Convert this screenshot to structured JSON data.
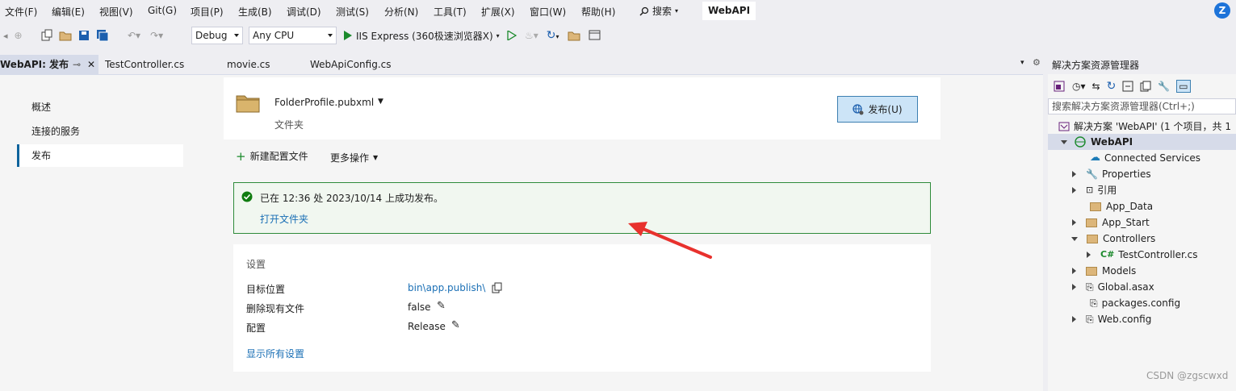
{
  "menu": {
    "items": [
      "文件(F)",
      "编辑(E)",
      "视图(V)",
      "Git(G)",
      "项目(P)",
      "生成(B)",
      "调试(D)",
      "测试(S)",
      "分析(N)",
      "工具(T)",
      "扩展(X)",
      "窗口(W)",
      "帮助(H)"
    ],
    "search_label": "搜索",
    "solution_name": "WebAPI",
    "avatar_letter": "Z"
  },
  "toolbar": {
    "config": "Debug",
    "platform": "Any CPU",
    "run_target": "IIS Express (360极速浏览器X)"
  },
  "tabs": {
    "active": "WebAPI: 发布",
    "files": [
      "TestController.cs",
      "movie.cs",
      "WebApiConfig.cs"
    ]
  },
  "left_nav": {
    "items": [
      "概述",
      "连接的服务",
      "发布"
    ],
    "selected": "发布"
  },
  "profile": {
    "name": "FolderProfile.pubxml",
    "type": "文件夹",
    "publish_button": "发布(U)"
  },
  "actions": {
    "new_profile": "新建配置文件",
    "more": "更多操作"
  },
  "status": {
    "message": "已在 12:36 处 2023/10/14 上成功发布。",
    "open_folder": "打开文件夹",
    "accent": "#107c10"
  },
  "settings": {
    "title": "设置",
    "rows": [
      {
        "label": "目标位置",
        "value": "bin\\app.publish\\"
      },
      {
        "label": "删除现有文件",
        "value": "false"
      },
      {
        "label": "配置",
        "value": "Release"
      }
    ],
    "show_all": "显示所有设置"
  },
  "solution_explorer": {
    "title": "解决方案资源管理器",
    "search_placeholder": "搜索解决方案资源管理器(Ctrl+;)",
    "solution_line": "解决方案 'WebAPI' (1 个项目，共 1",
    "project": "WebAPI",
    "items": [
      "Connected Services",
      "Properties",
      "引用",
      "App_Data",
      "App_Start",
      "Controllers",
      "TestController.cs",
      "Models",
      "Global.asax",
      "packages.config",
      "Web.config"
    ]
  },
  "watermark": "CSDN @zgscwxd",
  "annotation_color": "#e8312d"
}
